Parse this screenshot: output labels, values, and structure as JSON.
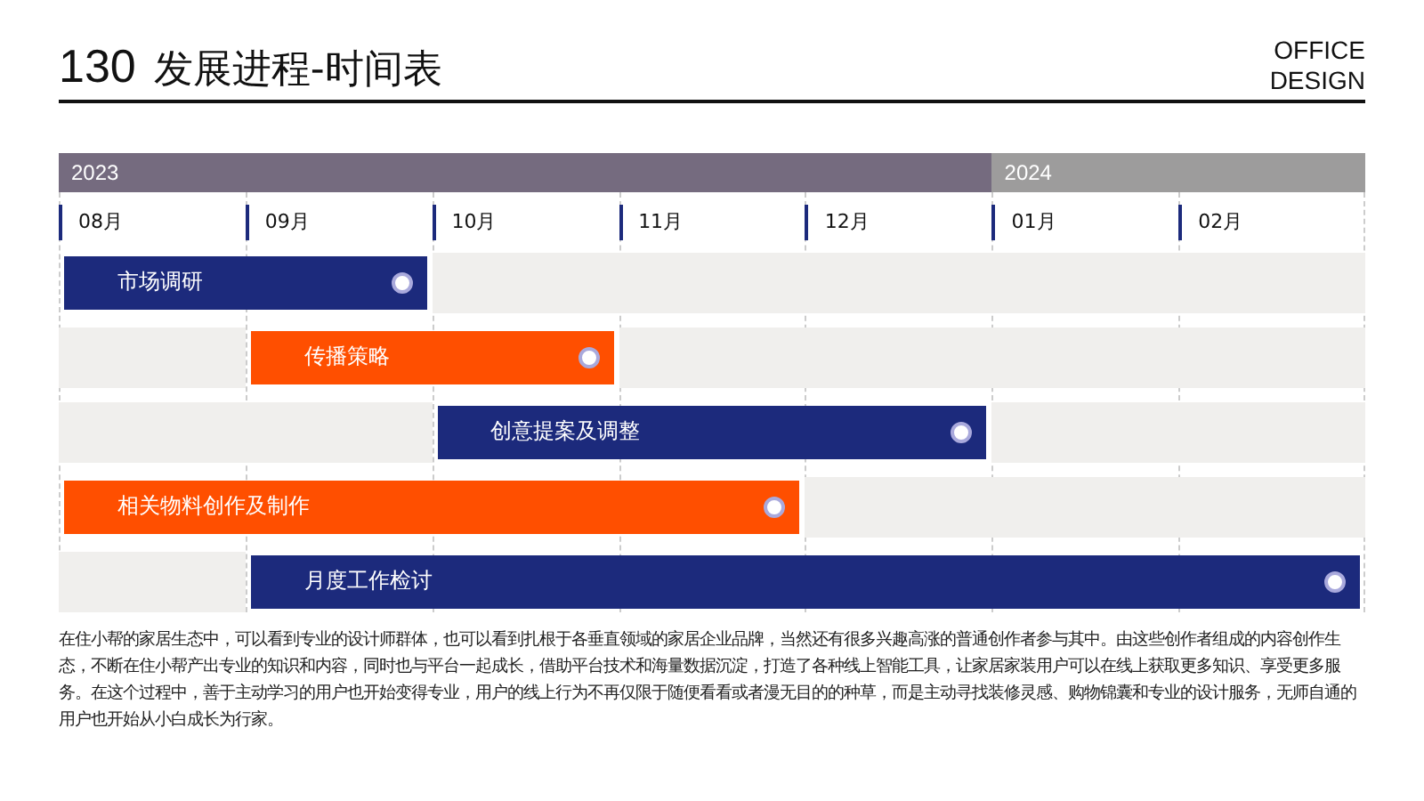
{
  "header": {
    "number": "130",
    "title": "发展进程-时间表",
    "brand_lines": [
      "OFFICE",
      "DESIGN"
    ]
  },
  "years": [
    {
      "label": "2023",
      "color": "#756b7f",
      "months": [
        "08月",
        "09月",
        "10月",
        "11月",
        "12月"
      ]
    },
    {
      "label": "2024",
      "color": "#9d9c9c",
      "months": [
        "01月",
        "02月"
      ]
    }
  ],
  "tasks": [
    {
      "label": "市场调研",
      "color": "#1c2a7c",
      "active": [
        true,
        true,
        false,
        false,
        false,
        false,
        false
      ]
    },
    {
      "label": "传播策略",
      "color": "#ff4f00",
      "active": [
        false,
        true,
        true,
        false,
        false,
        false,
        false
      ]
    },
    {
      "label": "创意提案及调整",
      "color": "#1c2a7c",
      "active": [
        false,
        false,
        true,
        true,
        true,
        false,
        false
      ]
    },
    {
      "label": "相关物料创作及制作",
      "color": "#ff4f00",
      "active": [
        true,
        true,
        true,
        true,
        false,
        false,
        false
      ]
    },
    {
      "label": "月度工作检讨",
      "color": "#1c2a7c",
      "active": [
        false,
        true,
        true,
        true,
        true,
        true,
        true
      ]
    }
  ],
  "description": "在住小帮的家居生态中，可以看到专业的设计师群体，也可以看到扎根于各垂直领域的家居企业品牌，当然还有很多兴趣高涨的普通创作者参与其中。由这些创作者组成的内容创作生态，不断在住小帮产出专业的知识和内容，同时也与平台一起成长，借助平台技术和海量数据沉淀，打造了各种线上智能工具，让家居家装用户可以在线上获取更多知识、享受更多服务。在这个过程中，善于主动学习的用户也开始变得专业，用户的线上行为不再仅限于随便看看或者漫无目的的种草，而是主动寻找装修灵感、购物锦囊和专业的设计服务，无师自通的用户也开始从小白成长为行家。"
}
